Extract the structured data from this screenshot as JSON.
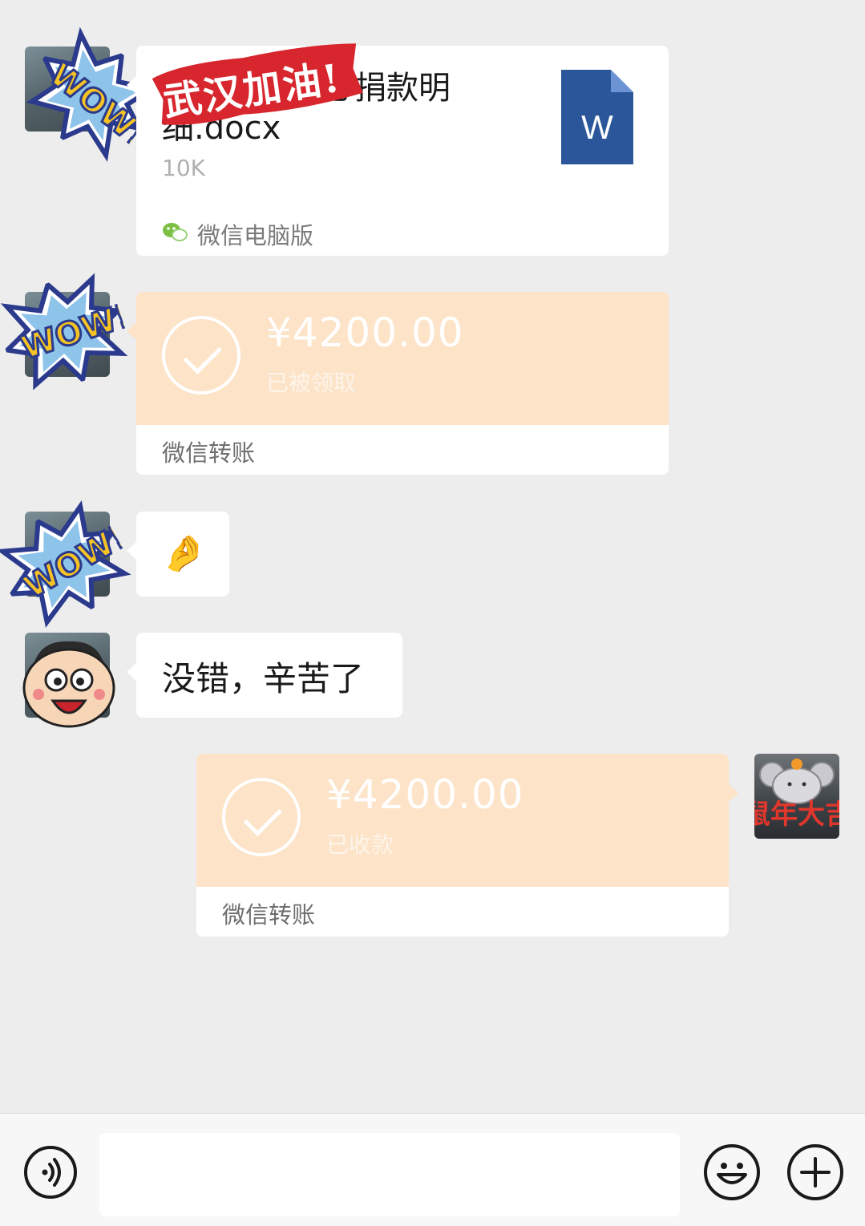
{
  "top_fragment": "· · · · ·",
  "messages": {
    "file_card": {
      "file_name": "武汉加油爱心捐款明细.docx",
      "file_size": "10K",
      "source": "微信电脑版",
      "file_type_letter": "W",
      "sticker_banner": "武汉加油!"
    },
    "transfer_received": {
      "amount": "¥4200.00",
      "status": "已被领取",
      "label": "微信转账"
    },
    "emoji_message": {
      "emoji": "🤌"
    },
    "text_message": {
      "text": "没错，辛苦了"
    },
    "transfer_sent": {
      "amount": "¥4200.00",
      "status": "已收款",
      "label": "微信转账",
      "avatar_sticker_text": "鼠年大吉"
    }
  },
  "stickers": {
    "wow": "WOW!"
  },
  "input_bar": {
    "placeholder": "",
    "voice_icon": "voice-icon",
    "emoji_icon": "smiley-icon",
    "plus_icon": "plus-icon"
  },
  "colors": {
    "background": "#ededed",
    "transfer_orange": "#fde3c7",
    "word_blue": "#2b579a",
    "banner_red": "#d7262d"
  }
}
